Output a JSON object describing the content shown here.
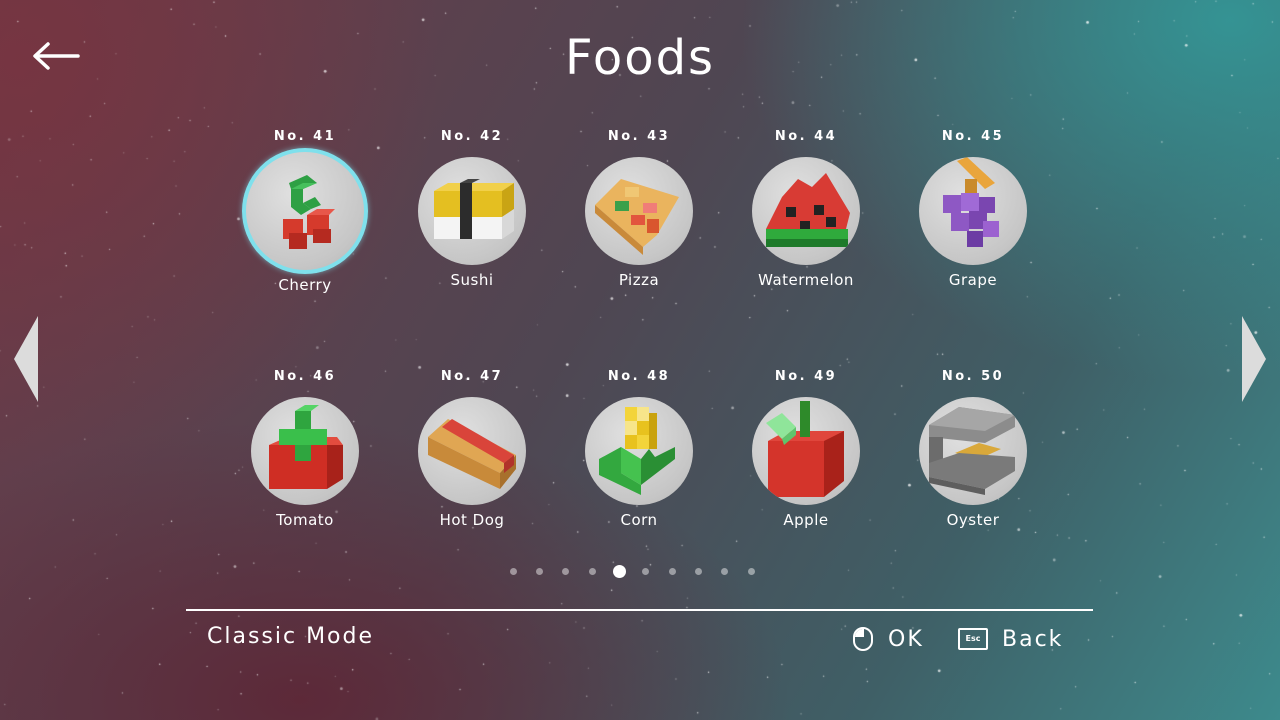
{
  "header": {
    "title": "Foods"
  },
  "items": [
    {
      "number": "No. 41",
      "name": "Cherry",
      "selected": true
    },
    {
      "number": "No. 42",
      "name": "Sushi"
    },
    {
      "number": "No. 43",
      "name": "Pizza"
    },
    {
      "number": "No. 44",
      "name": "Watermelon"
    },
    {
      "number": "No. 45",
      "name": "Grape"
    },
    {
      "number": "No. 46",
      "name": "Tomato"
    },
    {
      "number": "No. 47",
      "name": "Hot Dog"
    },
    {
      "number": "No. 48",
      "name": "Corn"
    },
    {
      "number": "No. 49",
      "name": "Apple"
    },
    {
      "number": "No. 50",
      "name": "Oyster"
    }
  ],
  "pagination": {
    "total_pages": 10,
    "current_page": 5
  },
  "footer": {
    "mode": "Classic Mode",
    "ok_label": "OK",
    "back_label": "Back",
    "esc_key": "Esc"
  },
  "colors": {
    "selection_ring": "#7fe0ec",
    "thumb_bg": "#cfcfcf"
  }
}
